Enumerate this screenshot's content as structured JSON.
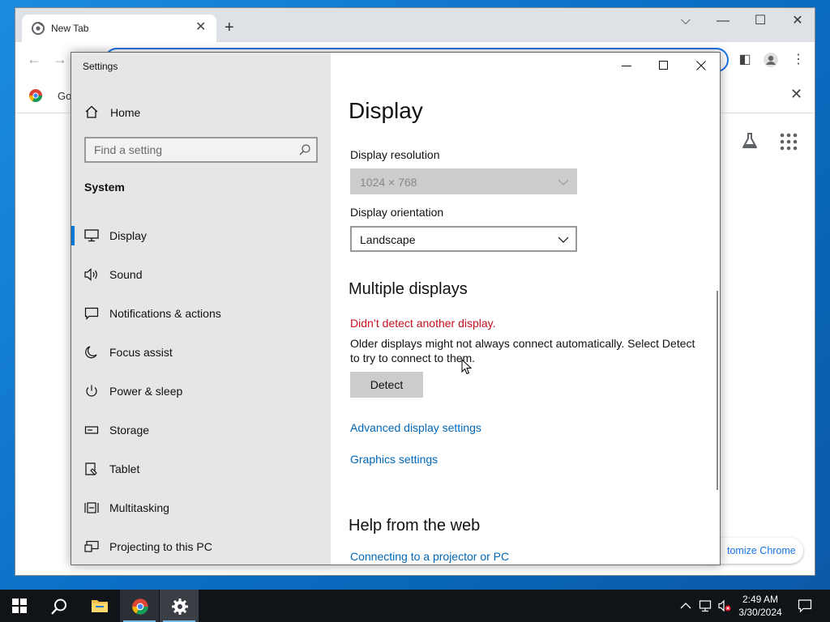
{
  "chrome": {
    "tab_title": "New Tab",
    "bookmark_label": "Go",
    "customize_label": "tomize Chrome"
  },
  "settings": {
    "app_title": "Settings",
    "home_label": "Home",
    "search_placeholder": "Find a setting",
    "section_label": "System",
    "nav_items": [
      {
        "label": "Display",
        "icon": "monitor-icon",
        "selected": true
      },
      {
        "label": "Sound",
        "icon": "speaker-icon"
      },
      {
        "label": "Notifications & actions",
        "icon": "notification-icon"
      },
      {
        "label": "Focus assist",
        "icon": "moon-icon"
      },
      {
        "label": "Power & sleep",
        "icon": "power-icon"
      },
      {
        "label": "Storage",
        "icon": "storage-icon"
      },
      {
        "label": "Tablet",
        "icon": "tablet-icon"
      },
      {
        "label": "Multitasking",
        "icon": "multitasking-icon"
      },
      {
        "label": "Projecting to this PC",
        "icon": "projecting-icon"
      }
    ],
    "page_title": "Display",
    "resolution_label": "Display resolution",
    "resolution_value": "1024 × 768",
    "orientation_label": "Display orientation",
    "orientation_value": "Landscape",
    "multiple_displays_heading": "Multiple displays",
    "error_text": "Didn’t detect another display.",
    "description": "Older displays might not always connect automatically. Select Detect to try to connect to them.",
    "detect_label": "Detect",
    "advanced_link": "Advanced display settings",
    "graphics_link": "Graphics settings",
    "help_heading": "Help from the web",
    "help_link": "Connecting to a projector or PC"
  },
  "taskbar": {
    "time": "2:49 AM",
    "date": "3/30/2024"
  },
  "colors": {
    "accent": "#0078d7",
    "link": "#0067b8",
    "error": "#c50f1f"
  }
}
